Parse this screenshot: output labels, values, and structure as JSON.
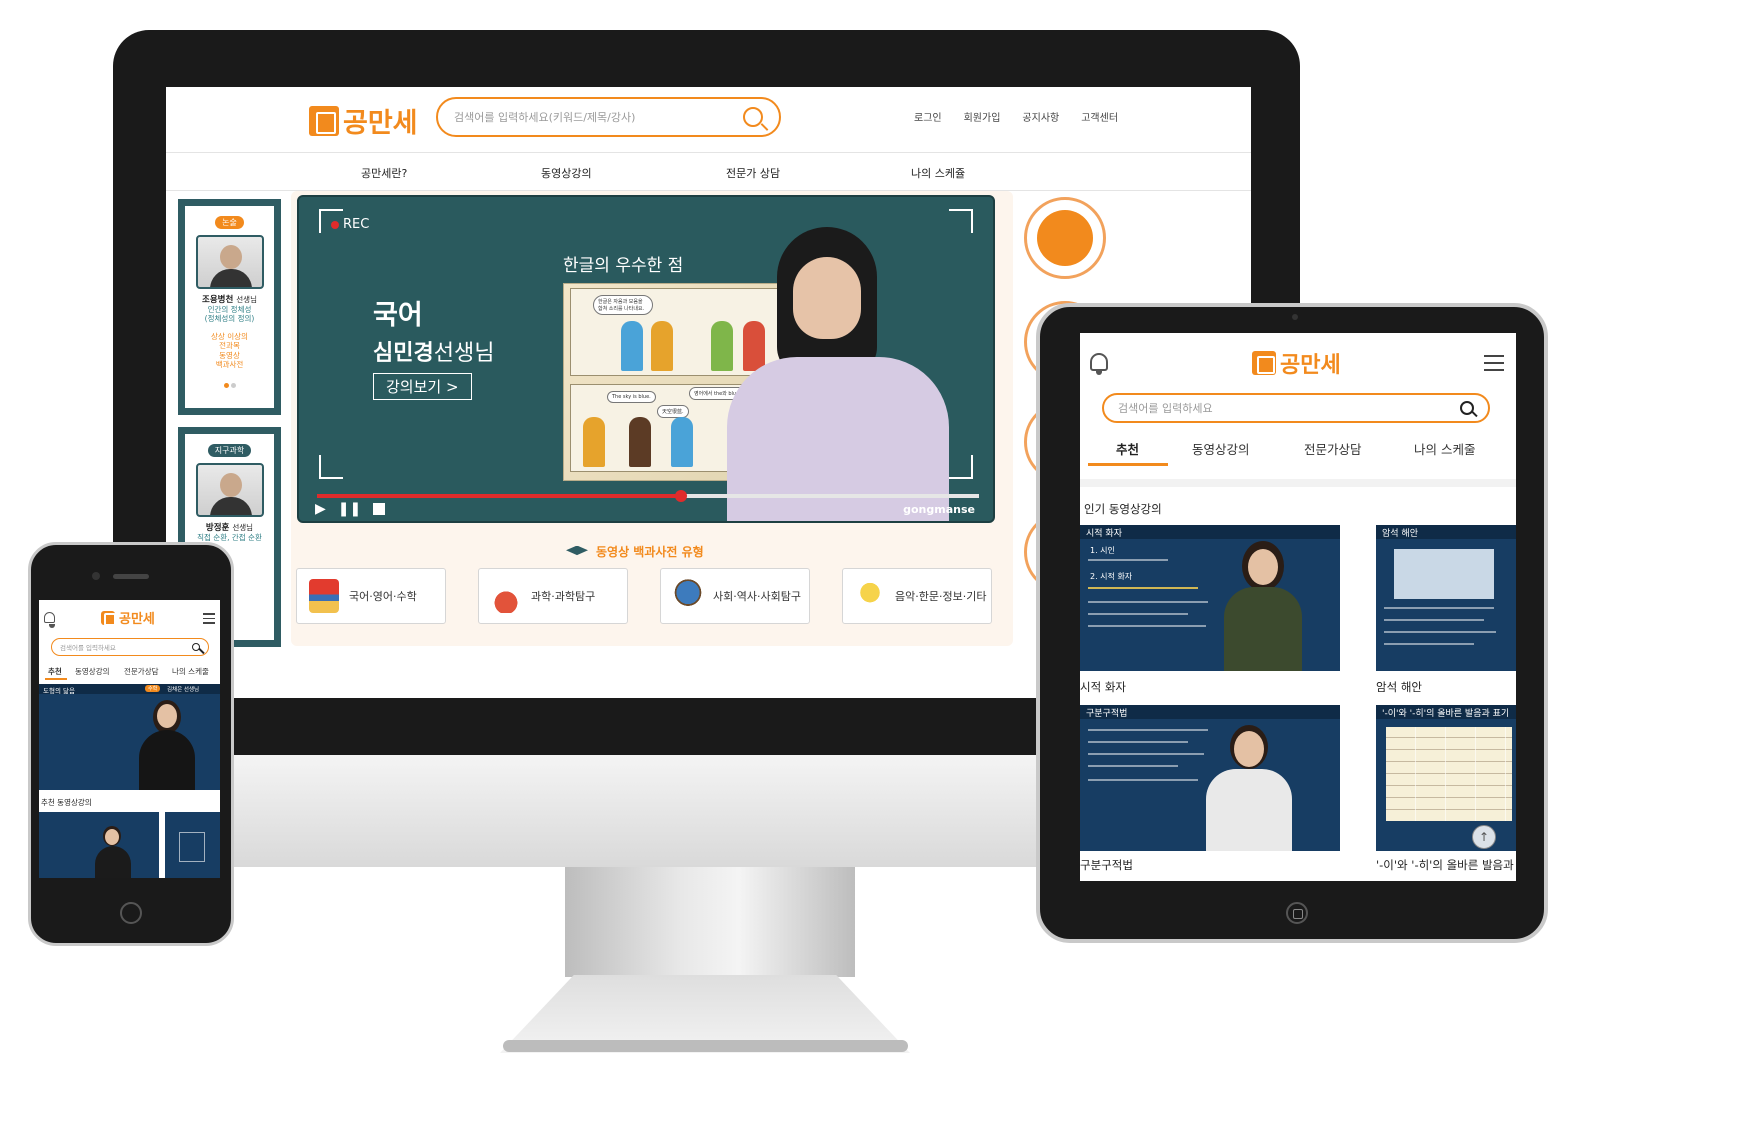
{
  "colors": {
    "accent": "#f28a1d",
    "teal": "#2f5c63",
    "lecture_blue": "#173d63"
  },
  "brand": {
    "logo_text": "공만세",
    "watermark": "gongmanse"
  },
  "desktop": {
    "search_placeholder": "검색어를 입력하세요(키워드/제목/강사)",
    "top_links": [
      "로그인",
      "회원가입",
      "공지사항",
      "고객센터"
    ],
    "nav": [
      "공만세란?",
      "동영상강의",
      "전문가 상담",
      "나의 스케쥴"
    ],
    "teachers": [
      {
        "badge": "논술",
        "name": "조용병천",
        "suffix": "선생님",
        "desc": [
          "인간의 정체성",
          "(정체성의 정의)"
        ],
        "links": [
          "상상 이상의",
          "전과목",
          "동영상",
          "백과사전"
        ]
      },
      {
        "badge": "지구과학",
        "name": "방정훈",
        "suffix": "선생님",
        "desc": [
          "직접 순환, 간접 순환"
        ]
      }
    ],
    "video": {
      "rec": "REC",
      "subject": "국어",
      "teacher_name": "심민경",
      "teacher_suffix": "선생님",
      "button": "강의보기 >",
      "headline": "한글의 우수한 점",
      "bubbles": [
        "한글은 자음과 모음을 합쳐 소리를 나타내요.",
        "The sky is blue.",
        "天空很蓝.",
        "영어에서 the와 blue의 e..."
      ],
      "progress": 0.55
    },
    "section_title": "동영상 백과사전 유형",
    "categories": [
      "국어·영어·수학",
      "과학·과학탐구",
      "사회·역사·사회탐구",
      "음악·한문·정보·기타"
    ]
  },
  "tablet": {
    "search_placeholder": "검색어를 입력하세요",
    "tabs": [
      "추천",
      "동영상강의",
      "전문가상담",
      "나의 스케줄"
    ],
    "active_tab": "추천",
    "section": "인기 동영상강의",
    "videos": [
      {
        "title": "시적 화자",
        "header": "시적 화자",
        "lines": [
          "1. 시인",
          "2. 시적 화자"
        ]
      },
      {
        "title": "암석 해안",
        "header": "암석 해안"
      },
      {
        "title": "구분구적법",
        "header": "구분구적법"
      },
      {
        "title": "'-이'와 '-히'의 올바른 발음과",
        "header": "'-이'와 '-히'의 올바른 발음과 표기"
      }
    ],
    "up_icon": "↑"
  },
  "phone": {
    "search_placeholder": "검색어를 입력하세요",
    "tabs": [
      "추천",
      "동영상강의",
      "전문가상담",
      "나의 스케줄"
    ],
    "hero": {
      "title": "도형의 닮음",
      "tag": "수학",
      "teacher": "김채은 선생님"
    },
    "section": "추천 동영상강의"
  }
}
